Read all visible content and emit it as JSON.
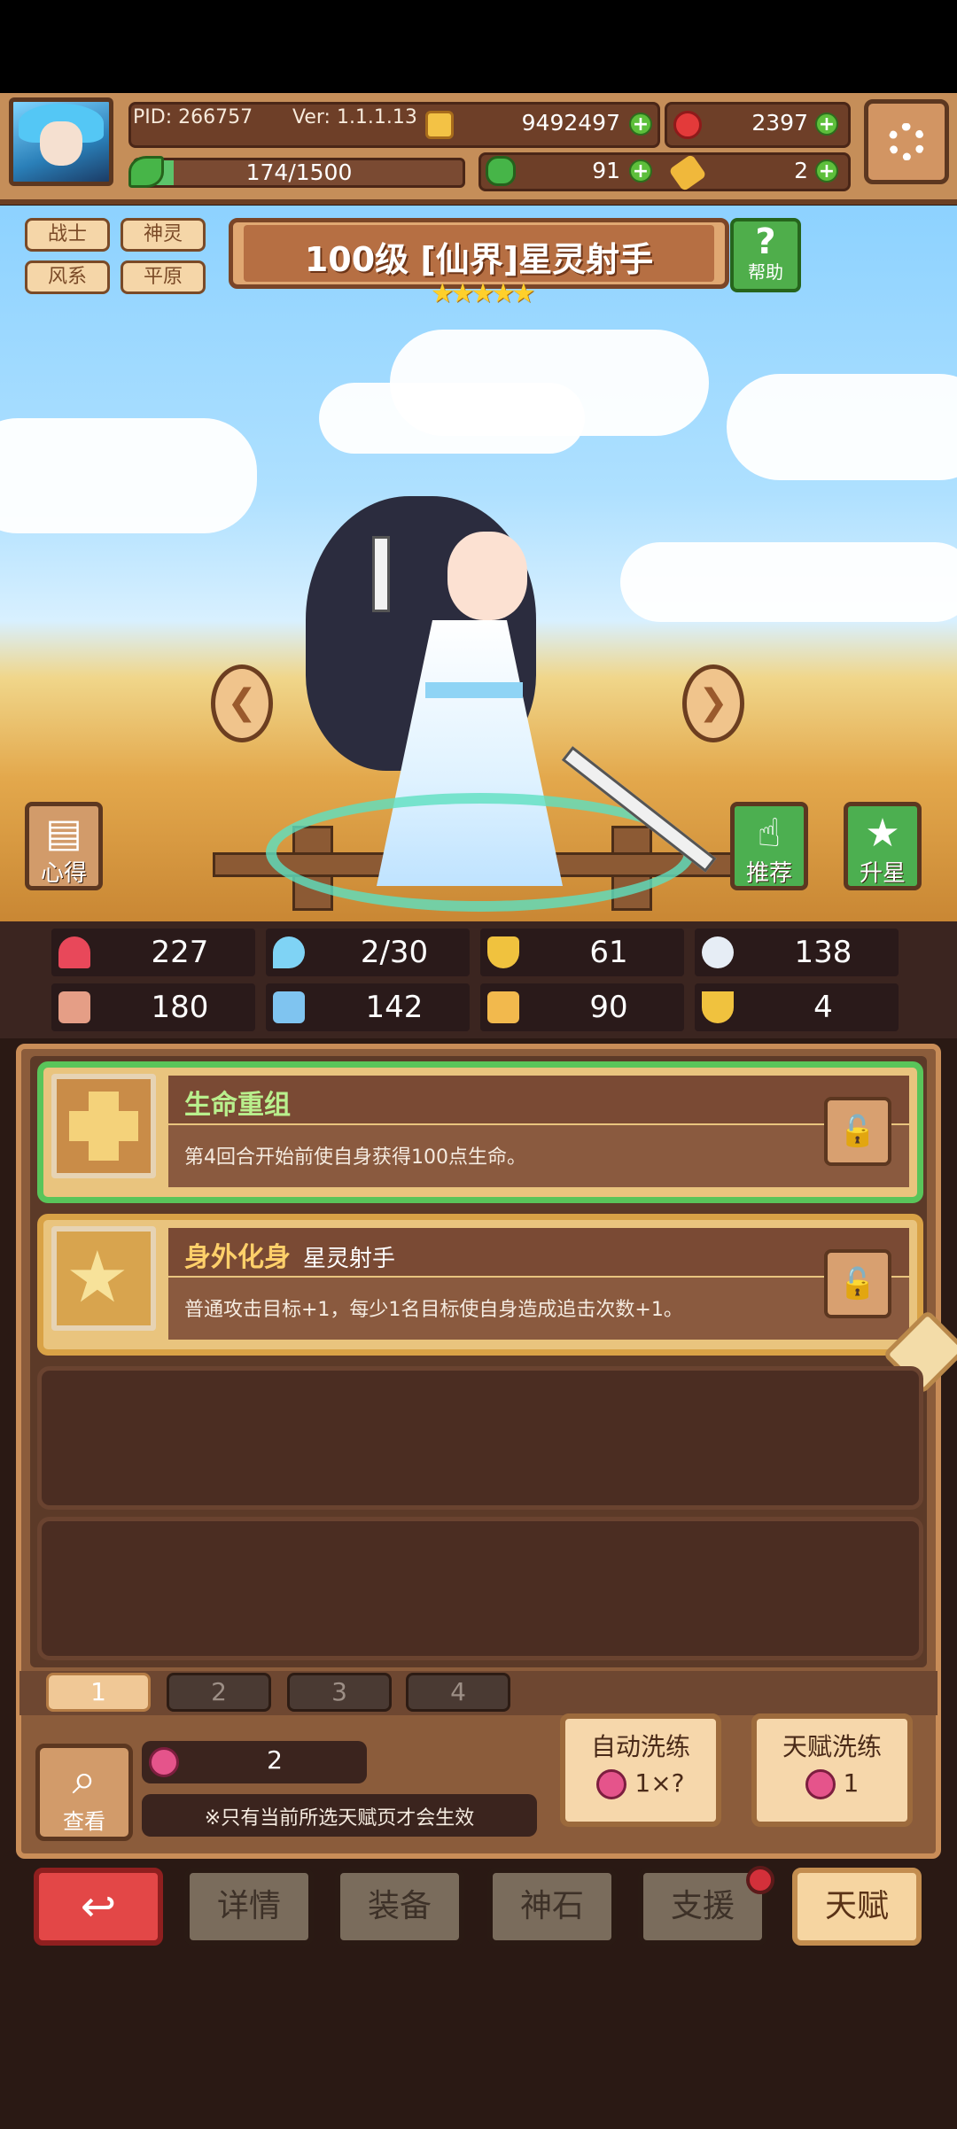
{
  "header": {
    "pid": "PID: 266757",
    "version": "Ver: 1.1.1.13",
    "coins": "9492497",
    "gems": "2397",
    "energy": "174/1500",
    "clovers": "91",
    "keys": "2",
    "energy_fraction": 0.116
  },
  "hero": {
    "tags": [
      "战士",
      "神灵",
      "风系",
      "平原"
    ],
    "title": "100级 [仙界]星灵射手",
    "stars": "★★★★★",
    "help_label": "帮助",
    "insight_label": "心得",
    "recommend_label": "推荐",
    "upstar_label": "升星"
  },
  "stats": {
    "hp": "227",
    "mana": "2/30",
    "defense": "61",
    "speed": "138",
    "attack": "180",
    "magic": "142",
    "crit": "90",
    "luck": "4"
  },
  "talents": [
    {
      "title": "生命重组",
      "subtitle": "",
      "desc": "第4回合开始前使自身获得100点生命。",
      "title_color": "#b9f08d"
    },
    {
      "title": "身外化身",
      "subtitle": "星灵射手",
      "desc": "普通攻击目标+1，每少1名目标使自身造成追击次数+1。",
      "title_color": "#ffd06a"
    }
  ],
  "pages": [
    "1",
    "2",
    "3",
    "4"
  ],
  "bottom_panel": {
    "lookup_label": "查看",
    "fruit_count": "2",
    "note": "※只有当前所选天赋页才会生效",
    "auto_refine_label": "自动洗练",
    "auto_refine_cost": "1×?",
    "talent_refine_label": "天赋洗练",
    "talent_refine_cost": "1"
  },
  "nav": {
    "details": "详情",
    "equipment": "装备",
    "stone": "神石",
    "support": "支援",
    "talent": "天赋"
  }
}
